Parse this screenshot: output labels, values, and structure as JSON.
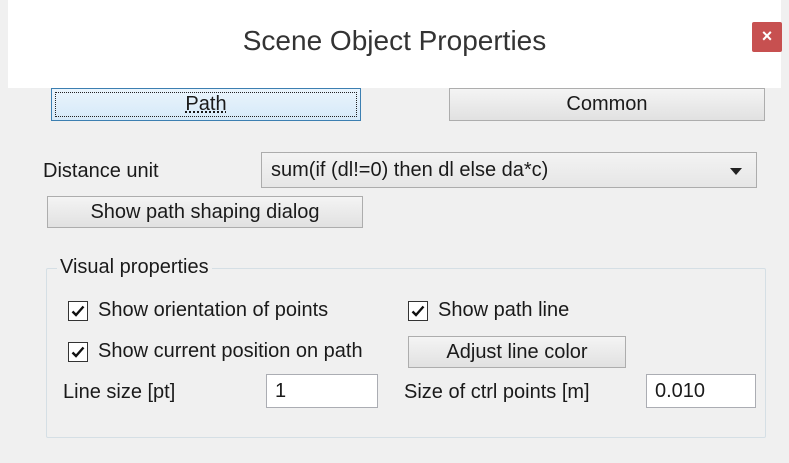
{
  "window": {
    "title": "Scene Object Properties",
    "close_glyph": "×"
  },
  "tabs": {
    "path_label": "Path",
    "common_label": "Common",
    "active": "Path"
  },
  "distance": {
    "label": "Distance unit",
    "value": "sum(if (dl!=0) then dl else da*c)"
  },
  "shaping_button": "Show path shaping dialog",
  "visual": {
    "legend": "Visual properties",
    "show_orientation": {
      "label": "Show orientation of points",
      "checked": true
    },
    "show_path_line": {
      "label": "Show path line",
      "checked": true
    },
    "show_current_position": {
      "label": "Show current position on path",
      "checked": true
    },
    "adjust_color_button": "Adjust line color",
    "line_size": {
      "label": "Line size [pt]",
      "value": "1"
    },
    "ctrl_points": {
      "label": "Size of ctrl points [m]",
      "value": "0.010"
    }
  },
  "colors": {
    "close_button": "#c75050",
    "focus_border": "#3c7fb1",
    "dialog_bg": "#f0f0f0"
  },
  "icons": {
    "close": "close-icon",
    "dropdown": "chevron-down-icon",
    "check": "check-icon"
  }
}
